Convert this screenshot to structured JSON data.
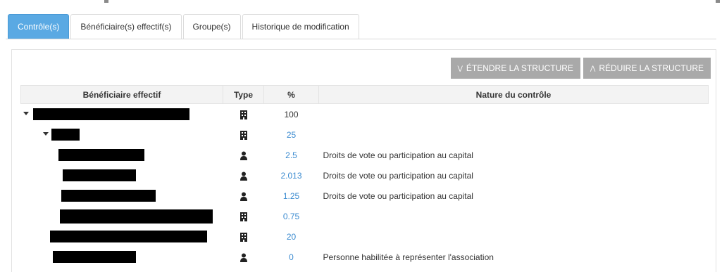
{
  "tabs": [
    {
      "label": "Contrôle(s)",
      "active": true
    },
    {
      "label": "Bénéficiaire(s) effectif(s)",
      "active": false
    },
    {
      "label": "Groupe(s)",
      "active": false
    },
    {
      "label": "Historique de modification",
      "active": false
    }
  ],
  "toolbar": {
    "expand_label": "ÉTENDRE LA STRUCTURE",
    "collapse_label": "RÉDUIRE LA STRUCTURE",
    "button_color": "#a9a9a9"
  },
  "table": {
    "headers": {
      "beneficiary": "Bénéficiaire effectif",
      "type": "Type",
      "percent": "%",
      "nature": "Nature du contrôle"
    },
    "rows": [
      {
        "type_icon": "building-icon",
        "percent": "100",
        "nature": "",
        "expandable": true
      },
      {
        "type_icon": "building-icon",
        "percent": "25",
        "nature": "",
        "expandable": true
      },
      {
        "type_icon": "person-icon",
        "percent": "2.5",
        "nature": "Droits de vote ou participation au capital",
        "expandable": false
      },
      {
        "type_icon": "person-icon",
        "percent": "2.013",
        "nature": "Droits de vote ou participation au capital",
        "expandable": false
      },
      {
        "type_icon": "person-icon",
        "percent": "1.25",
        "nature": "Droits de vote ou participation au capital",
        "expandable": false
      },
      {
        "type_icon": "building-icon",
        "percent": "0.75",
        "nature": "",
        "expandable": false
      },
      {
        "type_icon": "building-icon",
        "percent": "20",
        "nature": "",
        "expandable": false
      },
      {
        "type_icon": "person-icon",
        "percent": "0",
        "nature": "Personne habilitée à représenter l'association",
        "expandable": false
      }
    ]
  },
  "colors": {
    "active_tab": "#5aa9e3",
    "link_percent": "#3b8bd0",
    "redaction": "#000000"
  }
}
